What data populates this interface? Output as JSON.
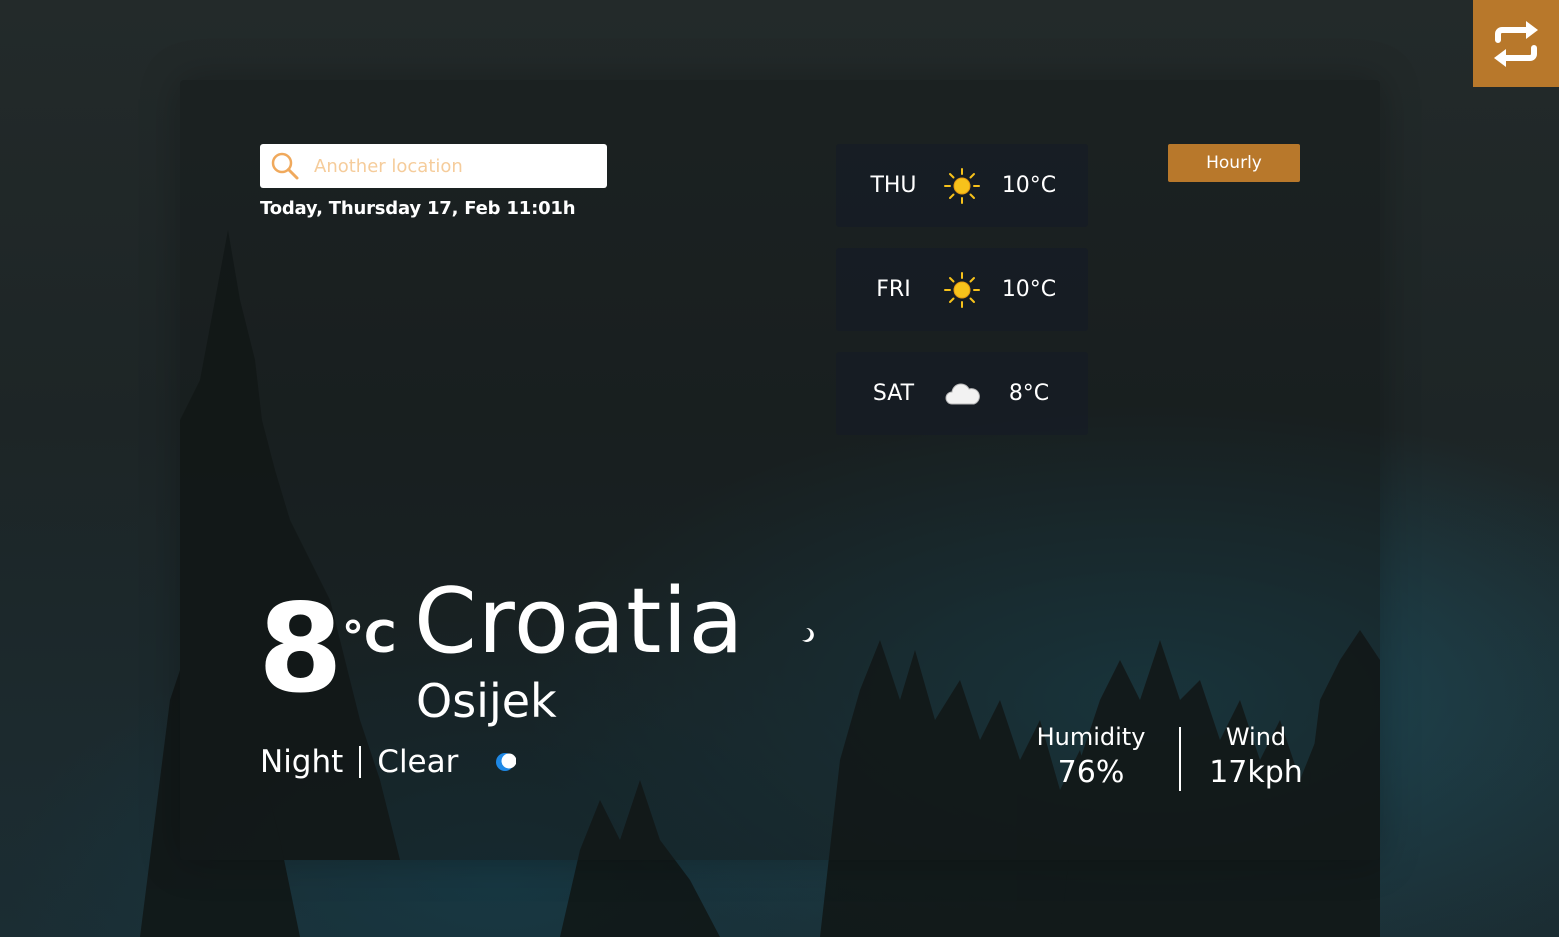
{
  "swap": {
    "icon": "swap-arrows-icon"
  },
  "search": {
    "placeholder": "Another location",
    "icon": "search-icon"
  },
  "date": {
    "text": "Today, Thursday 17, Feb 11:01h"
  },
  "forecast": [
    {
      "day": "THU",
      "icon": "sun-icon",
      "temp": "10°C"
    },
    {
      "day": "FRI",
      "icon": "sun-icon",
      "temp": "10°C"
    },
    {
      "day": "SAT",
      "icon": "cloud-icon",
      "temp": "8°C"
    }
  ],
  "hourly": {
    "label": "Hourly"
  },
  "current": {
    "temp": "8",
    "unit": "°C",
    "country": "Croatia",
    "city": "Osijek",
    "time_of_day": "Night",
    "condition": "Clear",
    "condition_icon": "moon-icon"
  },
  "stats": {
    "humidity_label": "Humidity",
    "humidity_value": "76%",
    "wind_label": "Wind",
    "wind_value": "17kph"
  },
  "colors": {
    "accent": "#b8782b",
    "search_icon": "#f0a95c",
    "sun": "#f7c21b",
    "moon": "#1e88e5"
  }
}
